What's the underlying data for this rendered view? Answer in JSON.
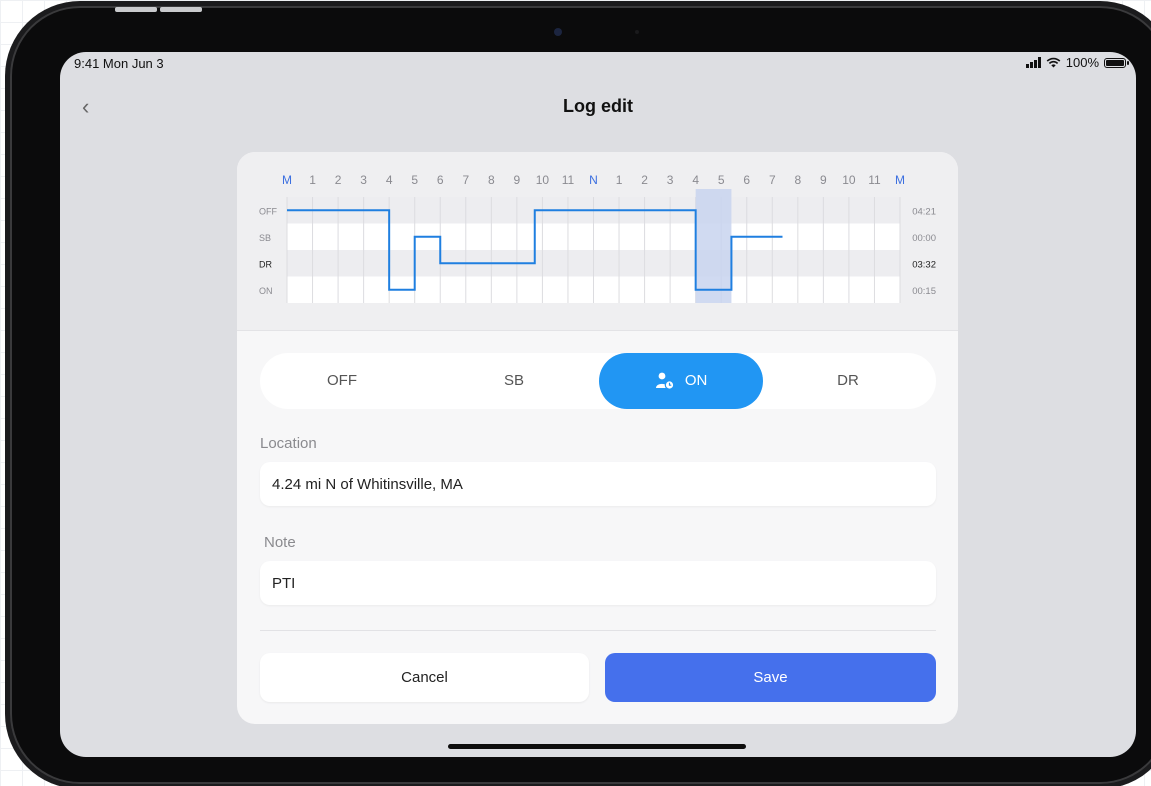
{
  "status_bar": {
    "time": "9:41 Mon Jun 3",
    "battery": "100%"
  },
  "header": {
    "title": "Log edit",
    "back_icon": "chevron-left-icon"
  },
  "chart_data": {
    "type": "line",
    "x_ticks": [
      "M",
      "1",
      "2",
      "3",
      "4",
      "5",
      "6",
      "7",
      "8",
      "9",
      "10",
      "11",
      "N",
      "1",
      "2",
      "3",
      "4",
      "5",
      "6",
      "7",
      "8",
      "9",
      "10",
      "11",
      "M"
    ],
    "highlight_ticks": [
      "M",
      "N",
      "M"
    ],
    "rows": [
      "OFF",
      "SB",
      "DR",
      "ON"
    ],
    "row_totals": [
      "04:21",
      "00:00",
      "03:32",
      "00:15"
    ],
    "bold_row": "DR",
    "x_range": [
      0,
      24
    ],
    "segments": [
      {
        "status": "OFF",
        "from": 0,
        "to": 4
      },
      {
        "status": "ON",
        "from": 4,
        "to": 5
      },
      {
        "status": "SB",
        "from": 5,
        "to": 6
      },
      {
        "status": "DR",
        "from": 6,
        "to": 9.7
      },
      {
        "status": "OFF",
        "from": 9.7,
        "to": 16
      },
      {
        "status": "ON",
        "from": 16,
        "to": 17.4
      },
      {
        "status": "SB",
        "from": 17.4,
        "to": 19.4
      }
    ],
    "selection": [
      16,
      17.4
    ],
    "colors": {
      "line": "#1f7fe0",
      "selection": "#c8d3ee",
      "tick_highlight": "#3b6fe0"
    }
  },
  "status_selector": {
    "options": [
      "OFF",
      "SB",
      "ON",
      "DR"
    ],
    "selected": "ON",
    "selected_icon": "person-clock-icon",
    "accent": "#2196f3"
  },
  "location": {
    "label": "Location",
    "value": "4.24 mi N of Whitinsville, MA"
  },
  "note": {
    "label": "Note",
    "value": "PTI"
  },
  "actions": {
    "cancel": "Cancel",
    "save": "Save",
    "save_color": "#4570ec"
  }
}
